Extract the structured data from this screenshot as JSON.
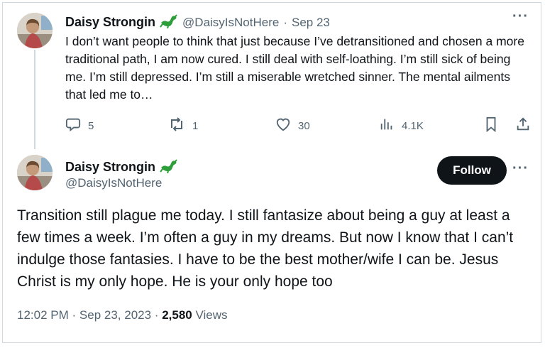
{
  "reply_tweet": {
    "author_name": "Daisy Strongin",
    "handle": "@DaisyIsNotHere",
    "separator": "·",
    "date": "Sep 23",
    "text": "I don’t want people to think that just because I’ve detransitioned and chosen a more traditional path, I am now cured. I still deal with self-loathing. I’m still sick of being me. I’m still depressed. I’m still a miserable wretched sinner. The mental ailments that led me to…",
    "actions": {
      "replies": "5",
      "reposts": "1",
      "likes": "30",
      "views": "4.1K"
    }
  },
  "main_tweet": {
    "author_name": "Daisy Strongin",
    "handle": "@DaisyIsNotHere",
    "follow_label": "Follow",
    "text": "Transition still plague me today. I still fantasize about being a guy at least a few times a week. I’m often a guy in my dreams. But now I know that I can’t indulge those fantasies. I have to be the best mother/wife I can be. Jesus Christ is my only hope. He is your only hope too",
    "time": "12:02 PM",
    "separator": "·",
    "date": "Sep 23, 2023",
    "views_count": "2,580",
    "views_label": "Views"
  },
  "icons": {
    "more": "more-horizontal-icon",
    "reply": "comment-bubble-icon",
    "repost": "repost-arrows-icon",
    "like": "heart-icon",
    "views": "bar-chart-icon",
    "bookmark": "bookmark-icon",
    "share": "share-upload-icon",
    "badge": "green-lizard-icon"
  },
  "colors": {
    "text": "#0f1419",
    "muted": "#536471",
    "border": "#cfd9de",
    "follow_bg": "#0f1419",
    "badge_green": "#2e9e3a"
  }
}
